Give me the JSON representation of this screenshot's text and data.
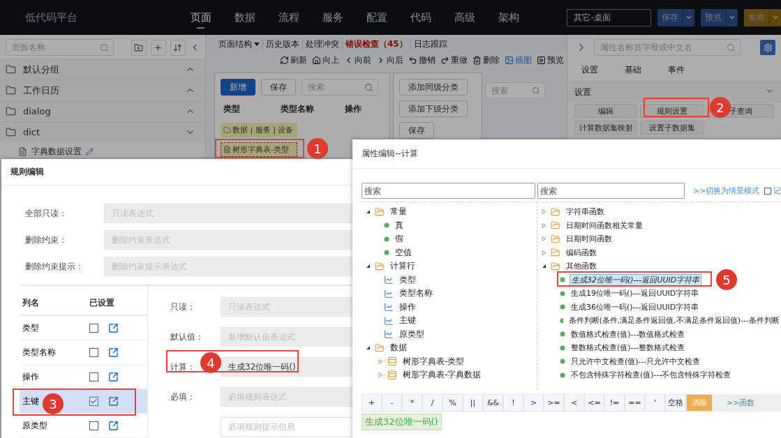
{
  "topbar": {
    "logo": "低代码平台",
    "nav": [
      {
        "label": "页面",
        "selected": true
      },
      {
        "label": "数据",
        "selected": false
      },
      {
        "label": "流程",
        "selected": false
      },
      {
        "label": "服务",
        "selected": false
      },
      {
        "label": "配置",
        "selected": false
      },
      {
        "label": "代码",
        "selected": false
      },
      {
        "label": "高级",
        "selected": false
      },
      {
        "label": "架构",
        "selected": false
      }
    ],
    "scene_select": "其它-桌面",
    "actions": [
      {
        "label": "保存",
        "kind": "primary"
      },
      {
        "label": "预览",
        "kind": "primary"
      },
      {
        "label": "发布",
        "kind": "warning"
      }
    ]
  },
  "left_panel": {
    "search": {
      "placeholder": "页面名称"
    },
    "groups": [
      {
        "name": "默认分组",
        "expanded": false
      },
      {
        "name": "工作日历",
        "expanded": false
      },
      {
        "name": "dialog",
        "expanded": false
      },
      {
        "name": "dict",
        "expanded": true,
        "children": [
          {
            "name": "字典数据设置"
          }
        ]
      }
    ]
  },
  "page_toolbar": {
    "tabs": [
      {
        "label": "页面结构",
        "kind": "dropdown"
      },
      {
        "label": "历史版本",
        "kind": "plain"
      },
      {
        "label": "处理冲突",
        "kind": "plain"
      },
      {
        "label": "错误检查（45）",
        "kind": "error"
      },
      {
        "label": "日志跟踪",
        "kind": "plain"
      }
    ],
    "actions": [
      {
        "label": "刷新",
        "kind": "refresh",
        "selected": false
      },
      {
        "label": "向上",
        "kind": "up",
        "selected": false
      },
      {
        "label": "向前",
        "kind": "back",
        "selected": false
      },
      {
        "label": "向后",
        "kind": "forward",
        "selected": false
      },
      {
        "label": "撤销",
        "kind": "undo",
        "selected": false
      },
      {
        "label": "重做",
        "kind": "redo",
        "selected": false
      },
      {
        "label": "删除",
        "kind": "delete",
        "selected": false
      },
      {
        "label": "插图",
        "kind": "image",
        "selected": true
      },
      {
        "label": "预览",
        "kind": "preview",
        "selected": false
      }
    ]
  },
  "canvas": {
    "buttons": [
      {
        "label": "新增",
        "kind": "primary"
      },
      {
        "label": "保存",
        "kind": "default"
      }
    ],
    "search": {
      "placeholder": "搜索"
    },
    "columns": [
      "类型",
      "类型名称",
      "操作"
    ],
    "rows": [
      {
        "label": "数据 | 服务 | 设备",
        "kind": "folder",
        "selected": false
      },
      {
        "label": "树形字典表-类型",
        "kind": "item",
        "selected": true
      }
    ],
    "side_buttons": [
      "添加同级分类",
      "添加下级分类",
      "保存"
    ],
    "side_search": {
      "placeholder": "搜索"
    }
  },
  "right_panel": {
    "search": {
      "placeholder": "属性名称首字母或中文名"
    },
    "tabs": [
      "设置",
      "基础",
      "事件"
    ],
    "section": "设置",
    "buttons": [
      "编辑",
      "规则设置",
      "子查询",
      "计算数据集映射",
      "设置子数据集"
    ]
  },
  "rule_dialog": {
    "title": "规则编辑",
    "fields": [
      {
        "label": "全部只读：",
        "placeholder": "只读表达式"
      },
      {
        "label": "删除约束：",
        "placeholder": "删除约束表达式"
      },
      {
        "label": "删除约束提示：",
        "placeholder": "删除约束提示表达式"
      }
    ],
    "columns": {
      "headers": [
        "列名",
        "已设置"
      ],
      "rows": [
        {
          "name": "类型",
          "checked": false,
          "selected": false
        },
        {
          "name": "类型名称",
          "checked": false,
          "selected": false
        },
        {
          "name": "操作",
          "checked": false,
          "selected": false
        },
        {
          "name": "主键",
          "checked": true,
          "selected": true
        },
        {
          "name": "原类型",
          "checked": false,
          "selected": false
        }
      ]
    },
    "column_fields": [
      {
        "label": "只读：",
        "placeholder": "只读表达式"
      },
      {
        "label": "默认值：",
        "placeholder": "新增默认值表达式"
      },
      {
        "label": "计算：",
        "value": "生成32位唯一码()"
      },
      {
        "label": "必填：",
        "placeholder": "必填规则表达式"
      },
      {
        "placeholder": "必填规则提示信息"
      }
    ]
  },
  "calc_dialog": {
    "title": "属性编辑--计算",
    "left_search": {
      "placeholder": "搜索"
    },
    "right_search": {
      "placeholder": "搜索"
    },
    "mode_link": ">>切换为情景模式",
    "remember": {
      "label": "记",
      "checked": false
    },
    "left_tree": [
      {
        "kind": "group",
        "label": "常量",
        "expanded": true,
        "children": [
          {
            "kind": "constant",
            "label": "真"
          },
          {
            "kind": "constant",
            "label": "假"
          },
          {
            "kind": "constant",
            "label": "空值"
          }
        ]
      },
      {
        "kind": "group",
        "label": "计算行",
        "expanded": true,
        "children": [
          {
            "kind": "column",
            "label": "类型"
          },
          {
            "kind": "column",
            "label": "类型名称"
          },
          {
            "kind": "column",
            "label": "操作"
          },
          {
            "kind": "column",
            "label": "主键"
          },
          {
            "kind": "column",
            "label": "原类型"
          }
        ]
      },
      {
        "kind": "group",
        "label": "数据",
        "expanded": true,
        "children": [
          {
            "kind": "dataset",
            "label": "树形字典表-类型",
            "expanded": false
          },
          {
            "kind": "dataset",
            "label": "树形字典表-字典数据",
            "expanded": false
          }
        ]
      }
    ],
    "right_tree": [
      {
        "kind": "folder",
        "label": "字符串函数",
        "expanded": false
      },
      {
        "kind": "folder",
        "label": "日期时间函数相关常量",
        "expanded": false
      },
      {
        "kind": "folder",
        "label": "日期时间函数",
        "expanded": false
      },
      {
        "kind": "folder",
        "label": "编码函数",
        "expanded": false
      },
      {
        "kind": "folder",
        "label": "其他函数",
        "expanded": true,
        "children": [
          {
            "kind": "function",
            "label": "生成32位唯一码()---返回UUID字符串",
            "selected": true
          },
          {
            "kind": "function",
            "label": "生成19位唯一码()---返回UUID字符串",
            "selected": false
          },
          {
            "kind": "function",
            "label": "生成36位唯一码()---返回UUID字符串",
            "selected": false
          },
          {
            "kind": "function",
            "label": "条件判断(条件,满足条件返回值,不满足条件返回值)---条件判断",
            "selected": false
          },
          {
            "kind": "function",
            "label": "数值格式检查(值)---数值格式检查",
            "selected": false
          },
          {
            "kind": "function",
            "label": "整数格式检查(值)---整数格式检查",
            "selected": false
          },
          {
            "kind": "function",
            "label": "只允许中文检查(值)---只允许中文检查",
            "selected": false
          },
          {
            "kind": "function",
            "label": "不包含特殊字符检查(值)---不包含特殊字符检查",
            "selected": false
          }
        ]
      }
    ],
    "operators": [
      {
        "label": "+",
        "kind": "op"
      },
      {
        "label": "-",
        "kind": "op"
      },
      {
        "label": "*",
        "kind": "op"
      },
      {
        "label": "/",
        "kind": "op"
      },
      {
        "label": "%",
        "kind": "op"
      },
      {
        "label": "||",
        "kind": "op"
      },
      {
        "label": "&&",
        "kind": "op"
      },
      {
        "label": "!",
        "kind": "op"
      },
      {
        "label": ">",
        "kind": "op"
      },
      {
        "label": ">=",
        "kind": "op"
      },
      {
        "label": "<",
        "kind": "op"
      },
      {
        "label": "<=",
        "kind": "op"
      },
      {
        "label": "!=",
        "kind": "op"
      },
      {
        "label": "==",
        "kind": "op"
      },
      {
        "label": "'",
        "kind": "op"
      },
      {
        "label": "空格",
        "kind": "op"
      },
      {
        "label": "清除",
        "kind": "clear"
      }
    ],
    "function_link": ">>函数",
    "expression": "生成32位唯一码()"
  },
  "annotations": [
    {
      "number": "1"
    },
    {
      "number": "2"
    },
    {
      "number": "3"
    },
    {
      "number": "4"
    },
    {
      "number": "5"
    }
  ]
}
